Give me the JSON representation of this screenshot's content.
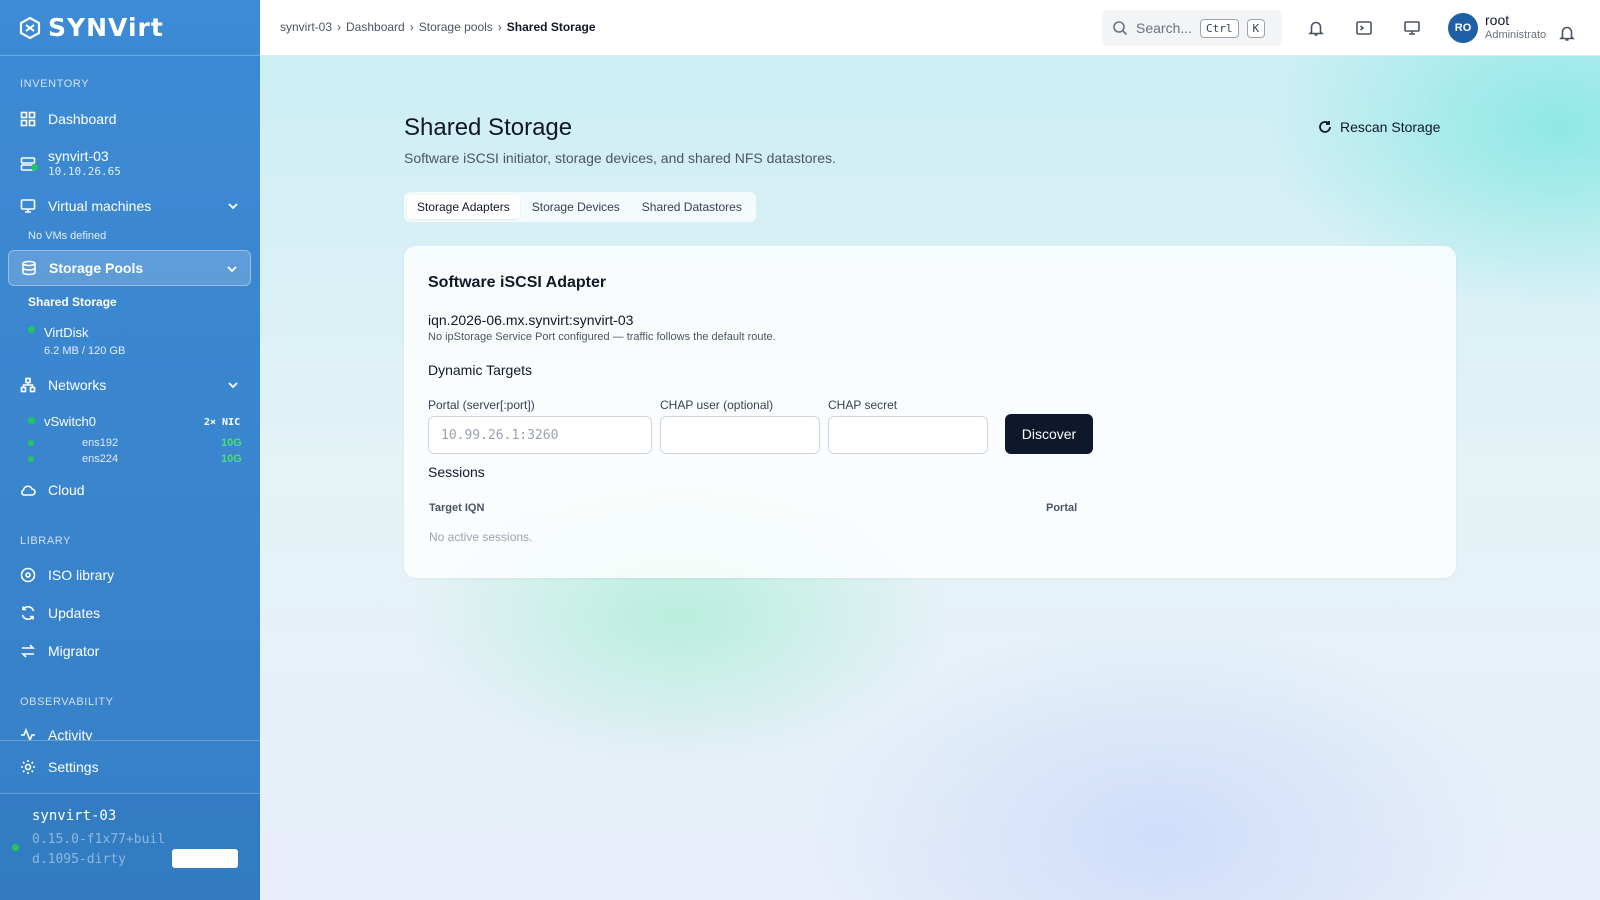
{
  "app": {
    "brand": "SYNVirt"
  },
  "sidebar": {
    "sections": {
      "inventory": "INVENTORY",
      "library": "LIBRARY",
      "observability": "OBSERVABILITY"
    },
    "dashboard": "Dashboard",
    "host": {
      "name": "synvirt-03",
      "ip": "10.10.26.65"
    },
    "vms": {
      "label": "Virtual machines",
      "empty": "No VMs defined"
    },
    "storage_pools": {
      "label": "Storage Pools",
      "shared": "Shared Storage",
      "disk_name": "VirtDisk",
      "disk_usage": "6.2 MB / 120 GB"
    },
    "networks": {
      "label": "Networks",
      "vswitch": "vSwitch0",
      "nic_count": "2× NIC",
      "nics": [
        {
          "name": "ens192",
          "speed": "10G"
        },
        {
          "name": "ens224",
          "speed": "10G"
        }
      ]
    },
    "cloud": "Cloud",
    "iso": "ISO library",
    "updates": "Updates",
    "migrator": "Migrator",
    "activity": "Activity",
    "settings": "Settings",
    "footer": {
      "host": "synvirt-03",
      "version": "0.15.0-f1x77+build.1095-dirty"
    }
  },
  "topbar": {
    "breadcrumb": [
      "synvirt-03",
      "Dashboard",
      "Storage pools",
      "Shared Storage"
    ],
    "search_placeholder": "Search...",
    "kbd1": "Ctrl",
    "kbd2": "K",
    "user": {
      "initials": "RO",
      "name": "root",
      "role": "Administrator"
    }
  },
  "page": {
    "title": "Shared Storage",
    "subtitle": "Software iSCSI initiator, storage devices, and shared NFS datastores.",
    "rescan": "Rescan Storage",
    "tabs": [
      "Storage Adapters",
      "Storage Devices",
      "Shared Datastores"
    ]
  },
  "card": {
    "title": "Software iSCSI Adapter",
    "iqn": "iqn.2026-06.mx.synvirt:synvirt-03",
    "iqn_note": "No ipStorage Service Port configured — traffic follows the default route.",
    "dynamic_targets": "Dynamic Targets",
    "portal_label": "Portal (server[:port])",
    "portal_placeholder": "10.99.26.1:3260",
    "chap_user_label": "CHAP user (optional)",
    "chap_secret_label": "CHAP secret",
    "discover": "Discover",
    "sessions": "Sessions",
    "col_target": "Target IQN",
    "col_portal": "Portal",
    "no_sessions": "No active sessions."
  },
  "colors": {
    "sidebar": "#3a86cf",
    "accent": "#0f172a",
    "status_ok": "#22c55e"
  }
}
